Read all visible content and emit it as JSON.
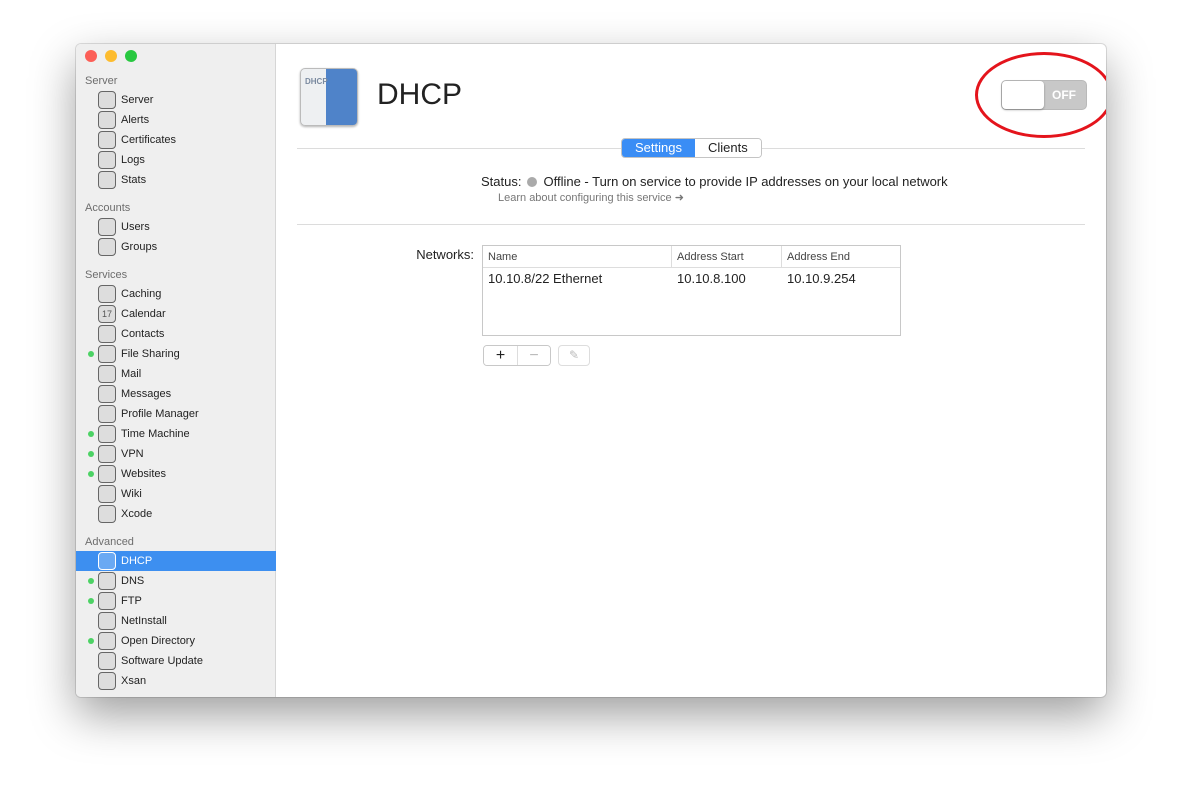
{
  "sidebar": {
    "sections": [
      {
        "title": "Server",
        "items": [
          {
            "label": "Server",
            "icon": "server-icon"
          },
          {
            "label": "Alerts",
            "icon": "megaphone-icon"
          },
          {
            "label": "Certificates",
            "icon": "certificate-icon"
          },
          {
            "label": "Logs",
            "icon": "log-icon"
          },
          {
            "label": "Stats",
            "icon": "stats-icon"
          }
        ]
      },
      {
        "title": "Accounts",
        "items": [
          {
            "label": "Users",
            "icon": "user-icon"
          },
          {
            "label": "Groups",
            "icon": "group-icon"
          }
        ]
      },
      {
        "title": "Services",
        "items": [
          {
            "label": "Caching",
            "icon": "caching-icon"
          },
          {
            "label": "Calendar",
            "icon": "calendar-icon"
          },
          {
            "label": "Contacts",
            "icon": "contacts-icon"
          },
          {
            "label": "File Sharing",
            "icon": "folder-icon",
            "active": true
          },
          {
            "label": "Mail",
            "icon": "mail-icon"
          },
          {
            "label": "Messages",
            "icon": "messages-icon"
          },
          {
            "label": "Profile Manager",
            "icon": "profile-icon"
          },
          {
            "label": "Time Machine",
            "icon": "time-machine-icon",
            "active": true
          },
          {
            "label": "VPN",
            "icon": "lock-icon",
            "active": true
          },
          {
            "label": "Websites",
            "icon": "globe-icon",
            "active": true
          },
          {
            "label": "Wiki",
            "icon": "wiki-icon"
          },
          {
            "label": "Xcode",
            "icon": "xcode-icon"
          }
        ]
      },
      {
        "title": "Advanced",
        "items": [
          {
            "label": "DHCP",
            "icon": "dhcp-icon",
            "selected": true
          },
          {
            "label": "DNS",
            "icon": "dns-icon",
            "active": true
          },
          {
            "label": "FTP",
            "icon": "ftp-icon",
            "active": true
          },
          {
            "label": "NetInstall",
            "icon": "netinstall-icon"
          },
          {
            "label": "Open Directory",
            "icon": "directory-icon",
            "active": true
          },
          {
            "label": "Software Update",
            "icon": "update-icon"
          },
          {
            "label": "Xsan",
            "icon": "xsan-icon"
          }
        ]
      }
    ]
  },
  "header": {
    "title": "DHCP",
    "icon_text": "DHCP",
    "toggle_label": "OFF"
  },
  "tabs": [
    "Settings",
    "Clients"
  ],
  "status": {
    "label": "Status:",
    "text": "Offline - Turn on service to provide IP addresses on your local network",
    "link": "Learn about configuring this service"
  },
  "networks": {
    "label": "Networks:",
    "columns": [
      "Name",
      "Address Start",
      "Address End"
    ],
    "rows": [
      [
        "10.10.8/22 Ethernet",
        "10.10.8.100",
        "10.10.9.254"
      ]
    ]
  },
  "colors": {
    "accent": "#3a8df5",
    "active_dot": "#4cd264",
    "annotation": "#e4141c"
  }
}
